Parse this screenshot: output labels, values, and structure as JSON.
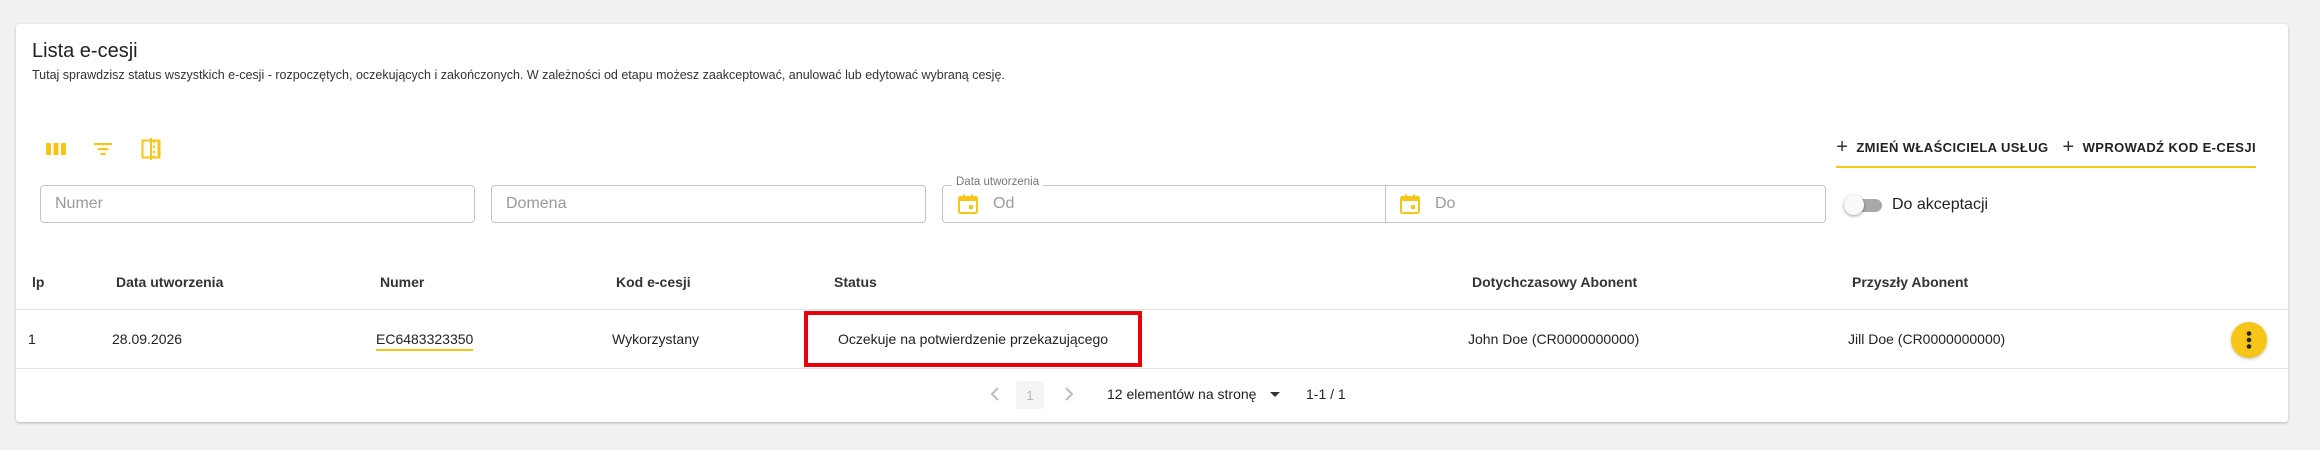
{
  "header": {
    "title": "Lista e-cesji",
    "description": "Tutaj sprawdzisz status wszystkich e-cesji - rozpoczętych, oczekujących i zakończonych. W zależności od etapu możesz zaakceptować, anulować lub edytować wybraną cesję."
  },
  "toolbar": {
    "icons": [
      "columns-icon",
      "filter-icon",
      "density-icon"
    ],
    "accent_color": "#f5c518",
    "change_owner_label": "ZMIEŃ WŁAŚCICIELA USŁUG",
    "enter_code_label": "WPROWADŹ KOD E-CESJI"
  },
  "filters": {
    "numer_placeholder": "Numer",
    "domena_placeholder": "Domena",
    "date_label": "Data utworzenia",
    "date_from_placeholder": "Od",
    "date_to_placeholder": "Do",
    "toggle_label": "Do akceptacji",
    "toggle_checked": false
  },
  "table": {
    "headers": [
      "lp",
      "Data utworzenia",
      "Numer",
      "Kod e-cesji",
      "Status",
      "Dotychczasowy Abonent",
      "Przyszły Abonent"
    ],
    "rows": [
      {
        "lp": "1",
        "date": "28.09.2026",
        "number": "EC6483323350",
        "code": "Wykorzystany",
        "status": "Oczekuje na potwierdzenie przekazującego",
        "current_subscriber": "John Doe (CR0000000000)",
        "future_subscriber": "Jill Doe (CR0000000000)"
      }
    ],
    "highlight_color": "#e8000b"
  },
  "pagination": {
    "current_page": "1",
    "per_page_label": "12 elementów na stronę",
    "range_label": "1-1 / 1"
  }
}
